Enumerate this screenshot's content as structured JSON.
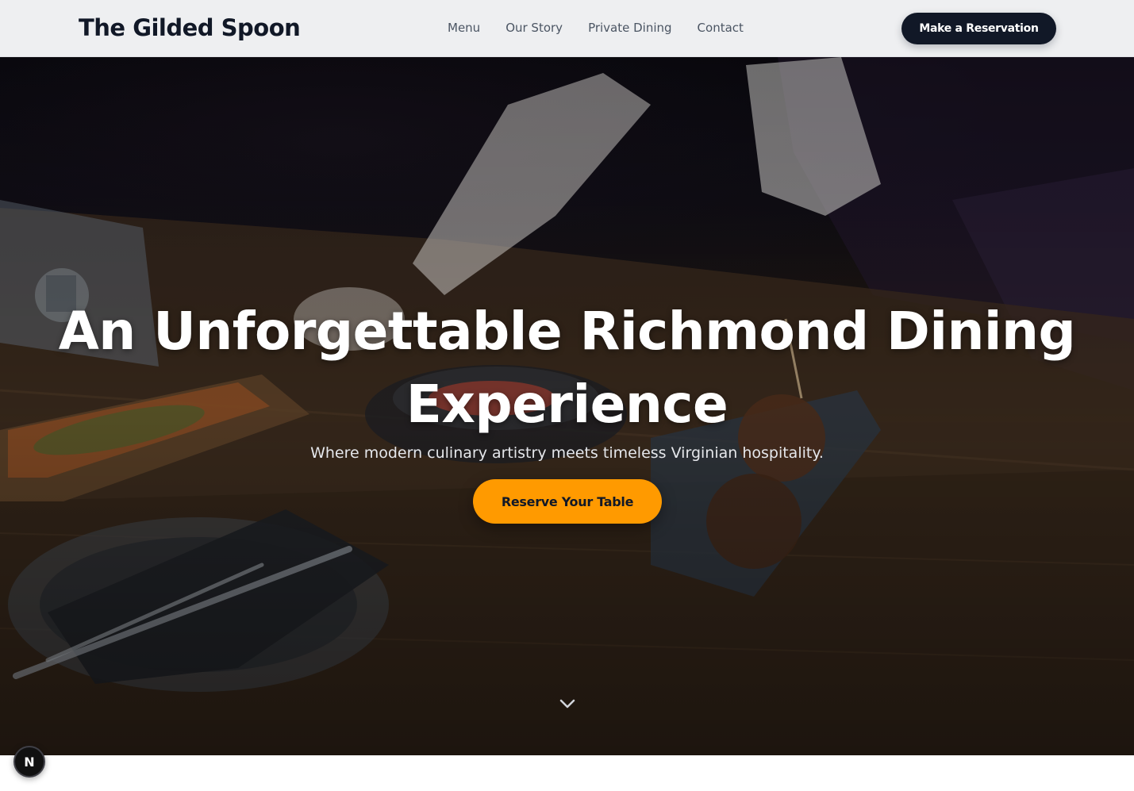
{
  "header": {
    "logo": "The Gilded Spoon",
    "nav": [
      {
        "label": "Menu"
      },
      {
        "label": "Our Story"
      },
      {
        "label": "Private Dining"
      },
      {
        "label": "Contact"
      }
    ],
    "cta_label": "Make a Reservation"
  },
  "hero": {
    "title_line1": "An Unforgettable Richmond Dining",
    "title_line2": "Experience",
    "subtitle": "Where modern culinary artistry meets timeless Virginian hospitality.",
    "cta_label": "Reserve Your Table",
    "scroll_icon": "chevron-down-icon",
    "background": "restaurant-table-photo"
  },
  "badge": {
    "letter": "N",
    "icon": "nextjs-logo-icon"
  },
  "colors": {
    "header_bg": "#eeeff1",
    "brand_dark": "#111827",
    "accent": "#ff9a00",
    "nav_text": "#4b5563"
  }
}
